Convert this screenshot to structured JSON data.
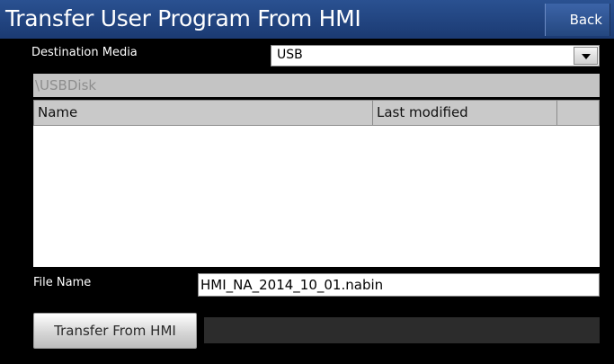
{
  "header": {
    "title": "Transfer User Program From HMI",
    "back_label": "Back"
  },
  "destination": {
    "label": "Destination Media",
    "selected": "USB"
  },
  "path": "\\USBDisk",
  "file_list": {
    "columns": [
      "Name",
      "Last modified",
      ""
    ],
    "rows": []
  },
  "file_name": {
    "label": "File Name",
    "value": "HMI_NA_2014_10_01.nabin"
  },
  "transfer": {
    "button_label": "Transfer From HMI",
    "progress": 0
  },
  "colors": {
    "titlebar": "#1f4280",
    "background": "#000000"
  }
}
